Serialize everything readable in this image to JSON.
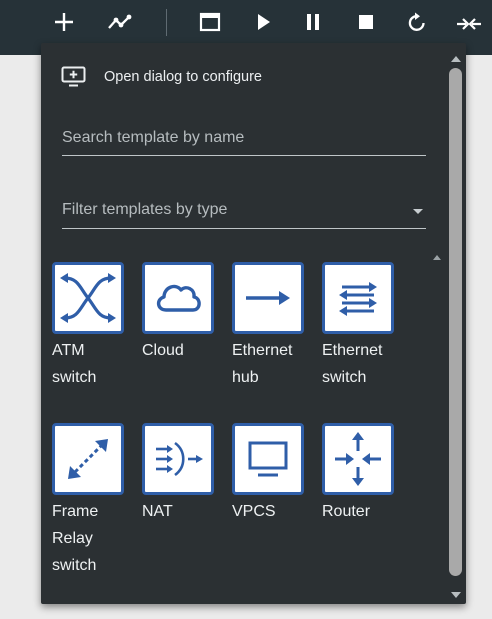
{
  "toolbar": {
    "icons": [
      "add-icon",
      "draw-link-icon",
      "fullscreen-icon",
      "play-icon",
      "pause-icon",
      "stop-icon",
      "reload-icon",
      "collapse-icon"
    ]
  },
  "panel": {
    "open_dialog_label": "Open dialog to configure",
    "search_placeholder": "Search template by name",
    "filter_placeholder": "Filter templates by type",
    "templates": [
      {
        "label": "ATM switch",
        "icon": "atm-switch-icon"
      },
      {
        "label": "Cloud",
        "icon": "cloud-icon"
      },
      {
        "label": "Ethernet hub",
        "icon": "ethernet-hub-icon"
      },
      {
        "label": "Ethernet switch",
        "icon": "ethernet-switch-icon"
      },
      {
        "label": "Frame Relay switch",
        "icon": "frame-relay-switch-icon"
      },
      {
        "label": "NAT",
        "icon": "nat-icon"
      },
      {
        "label": "VPCS",
        "icon": "vpcs-icon"
      },
      {
        "label": "Router",
        "icon": "router-icon"
      }
    ]
  },
  "colors": {
    "toolbar_bg": "#263238",
    "panel_bg": "#2b3033",
    "tile_border": "#2f5ea8",
    "page_bg": "#ebebeb"
  }
}
